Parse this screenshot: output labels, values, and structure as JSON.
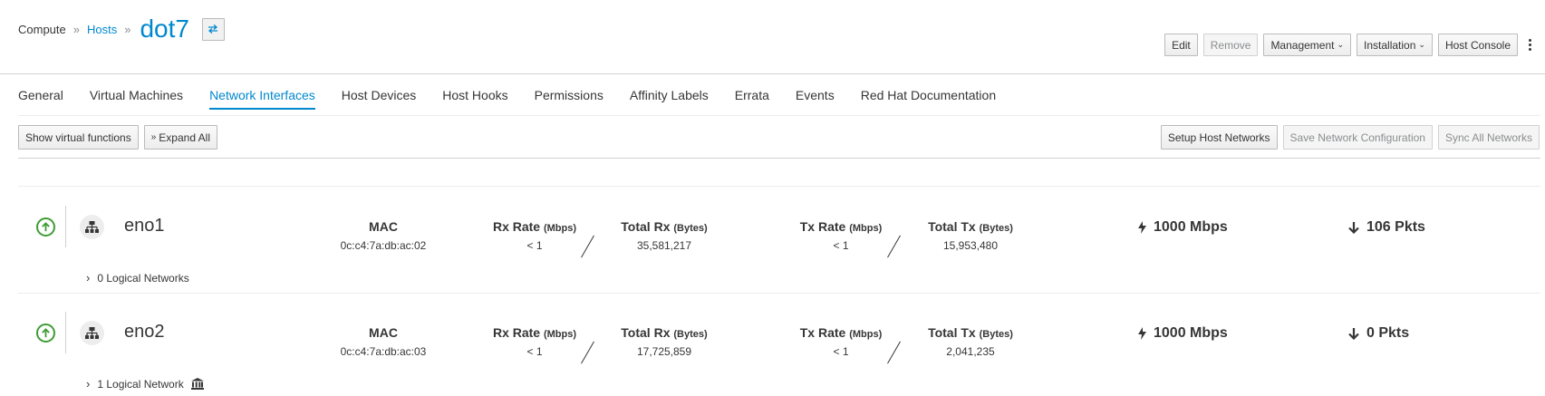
{
  "breadcrumb": {
    "compute": "Compute",
    "hosts": "Hosts",
    "sep": "»",
    "title": "dot7"
  },
  "header_actions": {
    "edit": "Edit",
    "remove": "Remove",
    "management": "Management",
    "installation": "Installation",
    "host_console": "Host Console"
  },
  "tabs": [
    {
      "label": "General"
    },
    {
      "label": "Virtual Machines"
    },
    {
      "label": "Network Interfaces",
      "active": true
    },
    {
      "label": "Host Devices"
    },
    {
      "label": "Host Hooks"
    },
    {
      "label": "Permissions"
    },
    {
      "label": "Affinity Labels"
    },
    {
      "label": "Errata"
    },
    {
      "label": "Events"
    },
    {
      "label": "Red Hat Documentation"
    }
  ],
  "toolbar": {
    "show_vf": "Show virtual functions",
    "expand_all": "Expand All",
    "setup_host_networks": "Setup Host Networks",
    "save_network_config": "Save Network Configuration",
    "sync_all_networks": "Sync All Networks"
  },
  "labels": {
    "mac": "MAC",
    "rx_rate": "Rx Rate",
    "total_rx": "Total Rx",
    "tx_rate": "Tx Rate",
    "total_tx": "Total Tx",
    "mbps_unit": "(Mbps)",
    "bytes_unit": "(Bytes)"
  },
  "nics": [
    {
      "name": "eno1",
      "status": "up",
      "mac": "0c:c4:7a:db:ac:02",
      "rx_rate": "< 1",
      "total_rx": "35,581,217",
      "tx_rate": "< 1",
      "total_tx": "15,953,480",
      "speed": "1000 Mbps",
      "drops": "106 Pkts",
      "logical": "0 Logical Networks"
    },
    {
      "name": "eno2",
      "status": "up",
      "mac": "0c:c4:7a:db:ac:03",
      "rx_rate": "< 1",
      "total_rx": "17,725,859",
      "tx_rate": "< 1",
      "total_tx": "2,041,235",
      "speed": "1000 Mbps",
      "drops": "0 Pkts",
      "logical": "1 Logical Network"
    }
  ],
  "colors": {
    "accent": "#0088ce",
    "status_up": "#3f9c35"
  }
}
